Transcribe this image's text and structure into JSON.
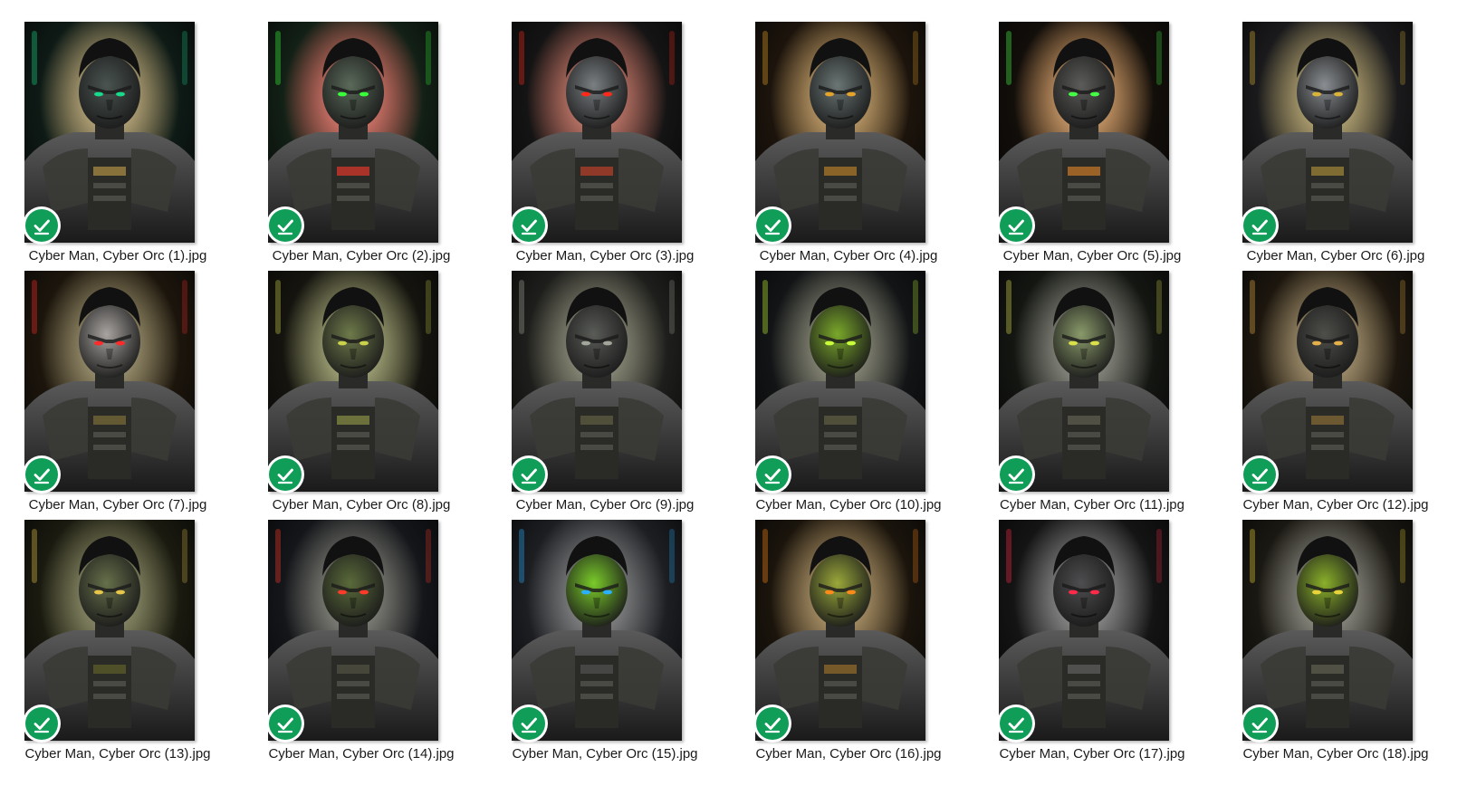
{
  "status_color": "#0f9d58",
  "status_icon": "synced-check-icon",
  "files": [
    {
      "name": "Cyber Man, Cyber Orc (1).jpg",
      "status": "available offline",
      "skin": "#4a5450",
      "glow": "#19d98a",
      "bg": "#0e1a16",
      "accent": "#c9a14a"
    },
    {
      "name": "Cyber Man, Cyber Orc (2).jpg",
      "status": "available offline",
      "skin": "#5a6a5a",
      "glow": "#39ff3a",
      "bg": "#122016",
      "accent": "#ff3b2a"
    },
    {
      "name": "Cyber Man, Cyber Orc (3).jpg",
      "status": "available offline",
      "skin": "#7a7f82",
      "glow": "#ff2a1a",
      "bg": "#141414",
      "accent": "#d6452a"
    },
    {
      "name": "Cyber Man, Cyber Orc (4).jpg",
      "status": "available offline",
      "skin": "#6a7675",
      "glow": "#e6a32a",
      "bg": "#1c140c",
      "accent": "#c98a2a"
    },
    {
      "name": "Cyber Man, Cyber Orc (5).jpg",
      "status": "available offline",
      "skin": "#5c5c5a",
      "glow": "#44ff44",
      "bg": "#120e0a",
      "accent": "#e8892a"
    },
    {
      "name": "Cyber Man, Cyber Orc (6).jpg",
      "status": "available offline",
      "skin": "#8a8e92",
      "glow": "#d9b23a",
      "bg": "#1a1a1c",
      "accent": "#b89a3a"
    },
    {
      "name": "Cyber Man, Cyber Orc (7).jpg",
      "status": "available offline",
      "skin": "#a8a4a0",
      "glow": "#ff2a2a",
      "bg": "#1c150c",
      "accent": "#8a7a3a"
    },
    {
      "name": "Cyber Man, Cyber Orc (8).jpg",
      "status": "available offline",
      "skin": "#6e7a4a",
      "glow": "#c9d24a",
      "bg": "#15140f",
      "accent": "#9aa04a"
    },
    {
      "name": "Cyber Man, Cyber Orc (9).jpg",
      "status": "available offline",
      "skin": "#5a5c58",
      "glow": "#a2a69a",
      "bg": "#1e1e1c",
      "accent": "#6a6a48"
    },
    {
      "name": "Cyber Man, Cyber Orc (10).jpg",
      "status": "available offline",
      "skin": "#7aa82a",
      "glow": "#c8ff3a",
      "bg": "#121416",
      "accent": "#6a6a48"
    },
    {
      "name": "Cyber Man, Cyber Orc (11).jpg",
      "status": "available offline",
      "skin": "#8a9a6a",
      "glow": "#d9e04a",
      "bg": "#141612",
      "accent": "#6a6a5a"
    },
    {
      "name": "Cyber Man, Cyber Orc (12).jpg",
      "status": "available offline",
      "skin": "#4e4e4a",
      "glow": "#e4b04a",
      "bg": "#1c160e",
      "accent": "#9a7a3a"
    },
    {
      "name": "Cyber Man, Cyber Orc (13).jpg",
      "status": "available offline",
      "skin": "#66704a",
      "glow": "#e8c64a",
      "bg": "#1a1a10",
      "accent": "#6a6a2a"
    },
    {
      "name": "Cyber Man, Cyber Orc (14).jpg",
      "status": "available offline",
      "skin": "#5a6a3a",
      "glow": "#ff3a2a",
      "bg": "#14161a",
      "accent": "#5a5a48"
    },
    {
      "name": "Cyber Man, Cyber Orc (15).jpg",
      "status": "available offline",
      "skin": "#7acb2a",
      "glow": "#2ab0ff",
      "bg": "#1c1e22",
      "accent": "#5a5a5a"
    },
    {
      "name": "Cyber Man, Cyber Orc (16).jpg",
      "status": "available offline",
      "skin": "#9aa83a",
      "glow": "#ff8a1a",
      "bg": "#1a140c",
      "accent": "#a87a2a"
    },
    {
      "name": "Cyber Man, Cyber Orc (17).jpg",
      "status": "available offline",
      "skin": "#4e4e50",
      "glow": "#ff2a4a",
      "bg": "#141414",
      "accent": "#6a6a6a"
    },
    {
      "name": "Cyber Man, Cyber Orc (18).jpg",
      "status": "available offline",
      "skin": "#8ab02a",
      "glow": "#e8d43a",
      "bg": "#1a1812",
      "accent": "#6a6a5a"
    }
  ]
}
